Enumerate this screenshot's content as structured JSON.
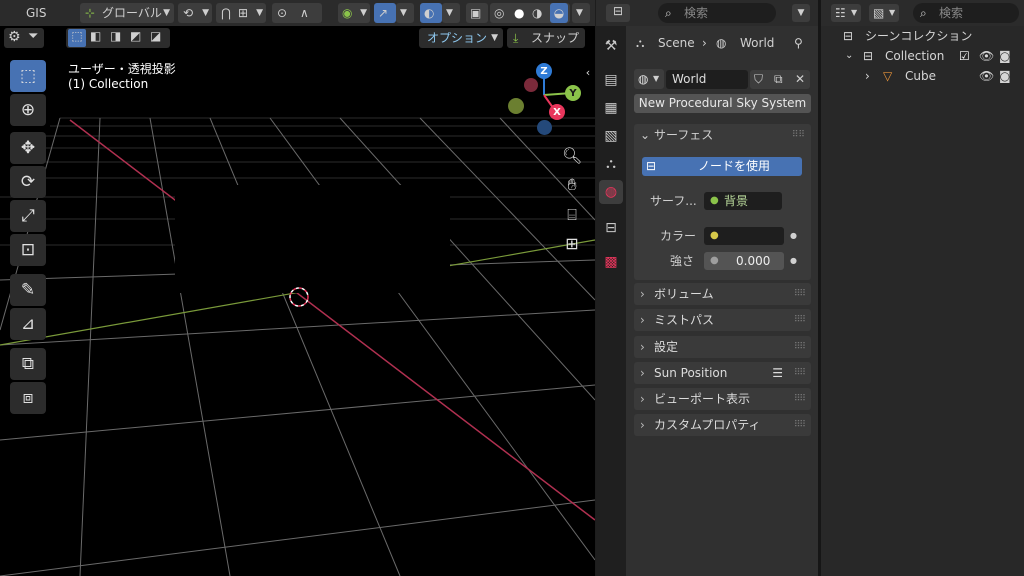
{
  "viewport_header": {
    "workspace": "GIS",
    "transform_orientation": "グローバル",
    "options_label": "オプション",
    "snap_label": "スナップ"
  },
  "viewport": {
    "view_name": "ユーザー・透視投影",
    "collection_label": "(1) Collection",
    "gizmo": {
      "z": "Z",
      "y": "Y",
      "x": "X"
    }
  },
  "properties": {
    "search_placeholder": "検索",
    "breadcrumb": {
      "scene": "Scene",
      "world": "World"
    },
    "world_name": "World",
    "sky_button": "New Procedural Sky System",
    "surface_panel": {
      "title": "サーフェス",
      "use_nodes": "ノードを使用",
      "surface_label": "サーフ...",
      "surface_value": "背景",
      "color_label": "カラー",
      "strength_label": "強さ",
      "strength_value": "0.000"
    },
    "panels": [
      "ボリューム",
      "ミストパス",
      "設定",
      "Sun Position",
      "ビューポート表示",
      "カスタムプロパティ"
    ]
  },
  "outliner": {
    "search_placeholder": "検索",
    "scene_collection": "シーンコレクション",
    "collection": "Collection",
    "cube": "Cube"
  },
  "colors": {
    "accent_blue": "#4772b3",
    "axis_x": "#e8365c",
    "axis_y": "#8bc34a",
    "axis_z": "#2f7bd6",
    "object_orange": "#e8943a"
  }
}
